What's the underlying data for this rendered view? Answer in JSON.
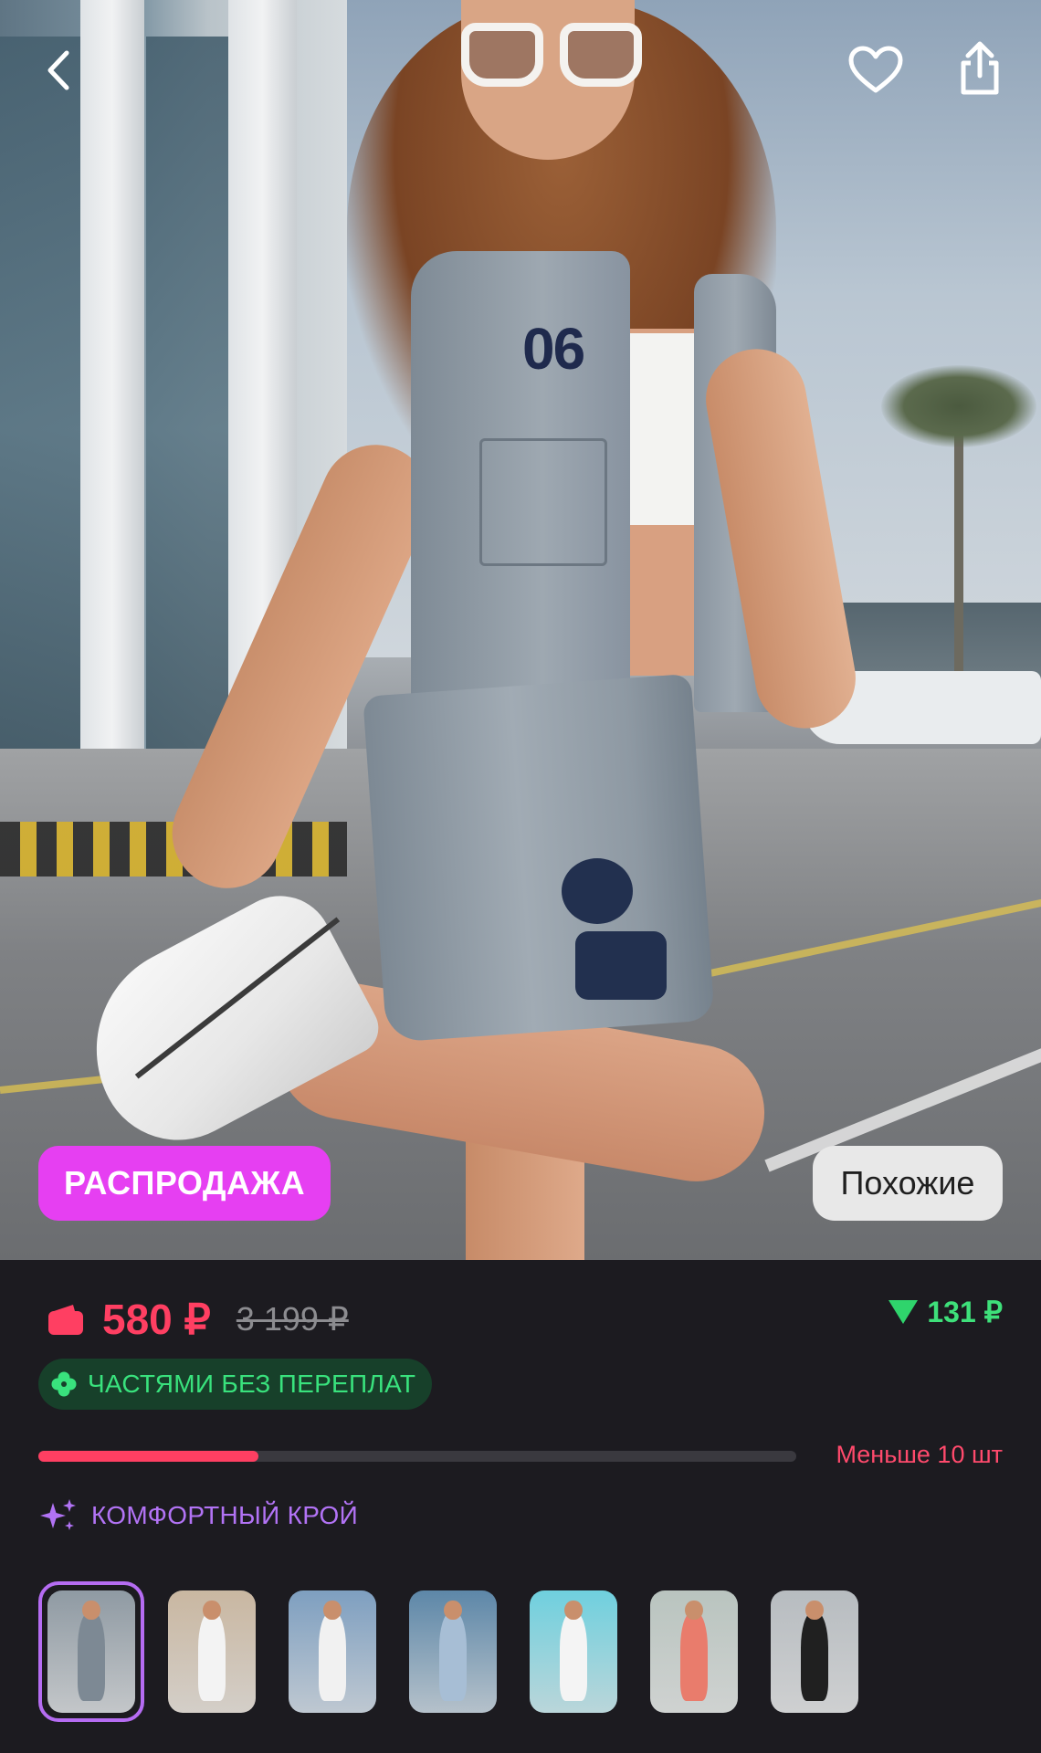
{
  "nav": {
    "back_icon": "chevron-left-icon",
    "favorite_icon": "heart-icon",
    "share_icon": "share-icon"
  },
  "hero": {
    "sale_badge": "РАСПРОДАЖА",
    "similar_button": "Похожие",
    "sale_color": "#e63ff2"
  },
  "price": {
    "current": "580 ₽",
    "old": "3 199 ₽",
    "drop": "131 ₽",
    "wallet_icon": "wallet-icon",
    "drop_icon": "triangle-down-icon",
    "accent": "#ff3f62",
    "drop_color": "#3ee07a"
  },
  "installments": {
    "label": "ЧАСТЯМИ БЕЗ ПЕРЕПЛАТ",
    "icon": "clover-icon"
  },
  "stock": {
    "label": "Меньше 10 шт",
    "level": 0.29
  },
  "feature": {
    "label": "КОМФОРТНЫЙ КРОЙ",
    "icon": "sparkle-icon",
    "color": "#b273f5"
  },
  "gallery": {
    "selected_index": 0,
    "thumbnails": [
      {
        "name": "product-photo-1",
        "bg": "#8f9aa3",
        "outfit": "#7d8994"
      },
      {
        "name": "product-photo-2",
        "bg": "#c9b7a1",
        "outfit": "#f3f3f3"
      },
      {
        "name": "product-photo-3",
        "bg": "#7e9fc0",
        "outfit": "#f1f1f1"
      },
      {
        "name": "product-photo-4",
        "bg": "#5d87a8",
        "outfit": "#a7bed5"
      },
      {
        "name": "product-photo-5",
        "bg": "#6fd0de",
        "outfit": "#f4f4f4"
      },
      {
        "name": "product-photo-6",
        "bg": "#b9c4bf",
        "outfit": "#e97c6c"
      },
      {
        "name": "product-photo-7",
        "bg": "#b7bcc0",
        "outfit": "#202020"
      }
    ]
  }
}
